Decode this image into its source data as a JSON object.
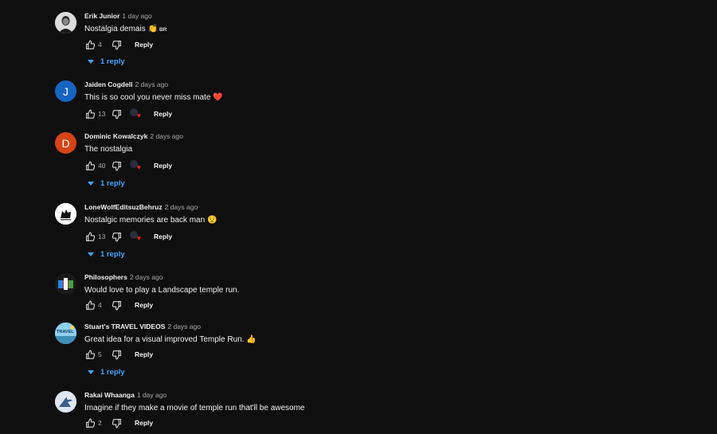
{
  "comments": [
    {
      "author": "Erik Junior",
      "time": "1 day ago",
      "text": "Nostalgia demais 👏",
      "badge": "BR",
      "likes": "4",
      "reply_label": "Reply",
      "replies_label": "1 reply",
      "avatar_icon": "person-photo-avatar"
    },
    {
      "author": "Jaiden Cogdell",
      "time": "2 days ago",
      "text": "This is so cool you never miss mate ❤️",
      "likes": "13",
      "reply_label": "Reply",
      "avatar_letter": "J",
      "avatar_color": "#1565c0",
      "hearted": true
    },
    {
      "author": "Dominic Kowalczyk",
      "time": "2 days ago",
      "text": "The nostalgia",
      "likes": "40",
      "reply_label": "Reply",
      "replies_label": "1 reply",
      "avatar_letter": "D",
      "avatar_color": "#d84315",
      "hearted": true
    },
    {
      "author": "LoneWolfEditsuzBehruz",
      "time": "2 days ago",
      "text": "Nostalgic memories are back man 😟",
      "likes": "13",
      "reply_label": "Reply",
      "replies_label": "1 reply",
      "avatar_icon": "wolf-logo-avatar",
      "hearted": true
    },
    {
      "author": "Philosophers",
      "time": "2 days ago",
      "text": "Would love to play a Landscape temple run.",
      "likes": "4",
      "reply_label": "Reply",
      "avatar_icon": "colorful-logo-avatar"
    },
    {
      "author": "Stuart's TRAVEL VIDEOS",
      "time": "2 days ago",
      "text": "Great idea for a visual improved Temple Run. 👍",
      "likes": "5",
      "reply_label": "Reply",
      "replies_label": "1 reply",
      "avatar_icon": "travel-logo-avatar"
    },
    {
      "author": "Rakai Whaanga",
      "time": "1 day ago",
      "text": "Imagine if they make a movie of temple run that'll be awesome",
      "likes": "2",
      "reply_label": "Reply",
      "avatar_icon": "bird-photo-avatar"
    }
  ],
  "colors": {
    "background": "#0f0f0f",
    "link_blue": "#3ea6ff",
    "heart_red": "#e62117"
  }
}
